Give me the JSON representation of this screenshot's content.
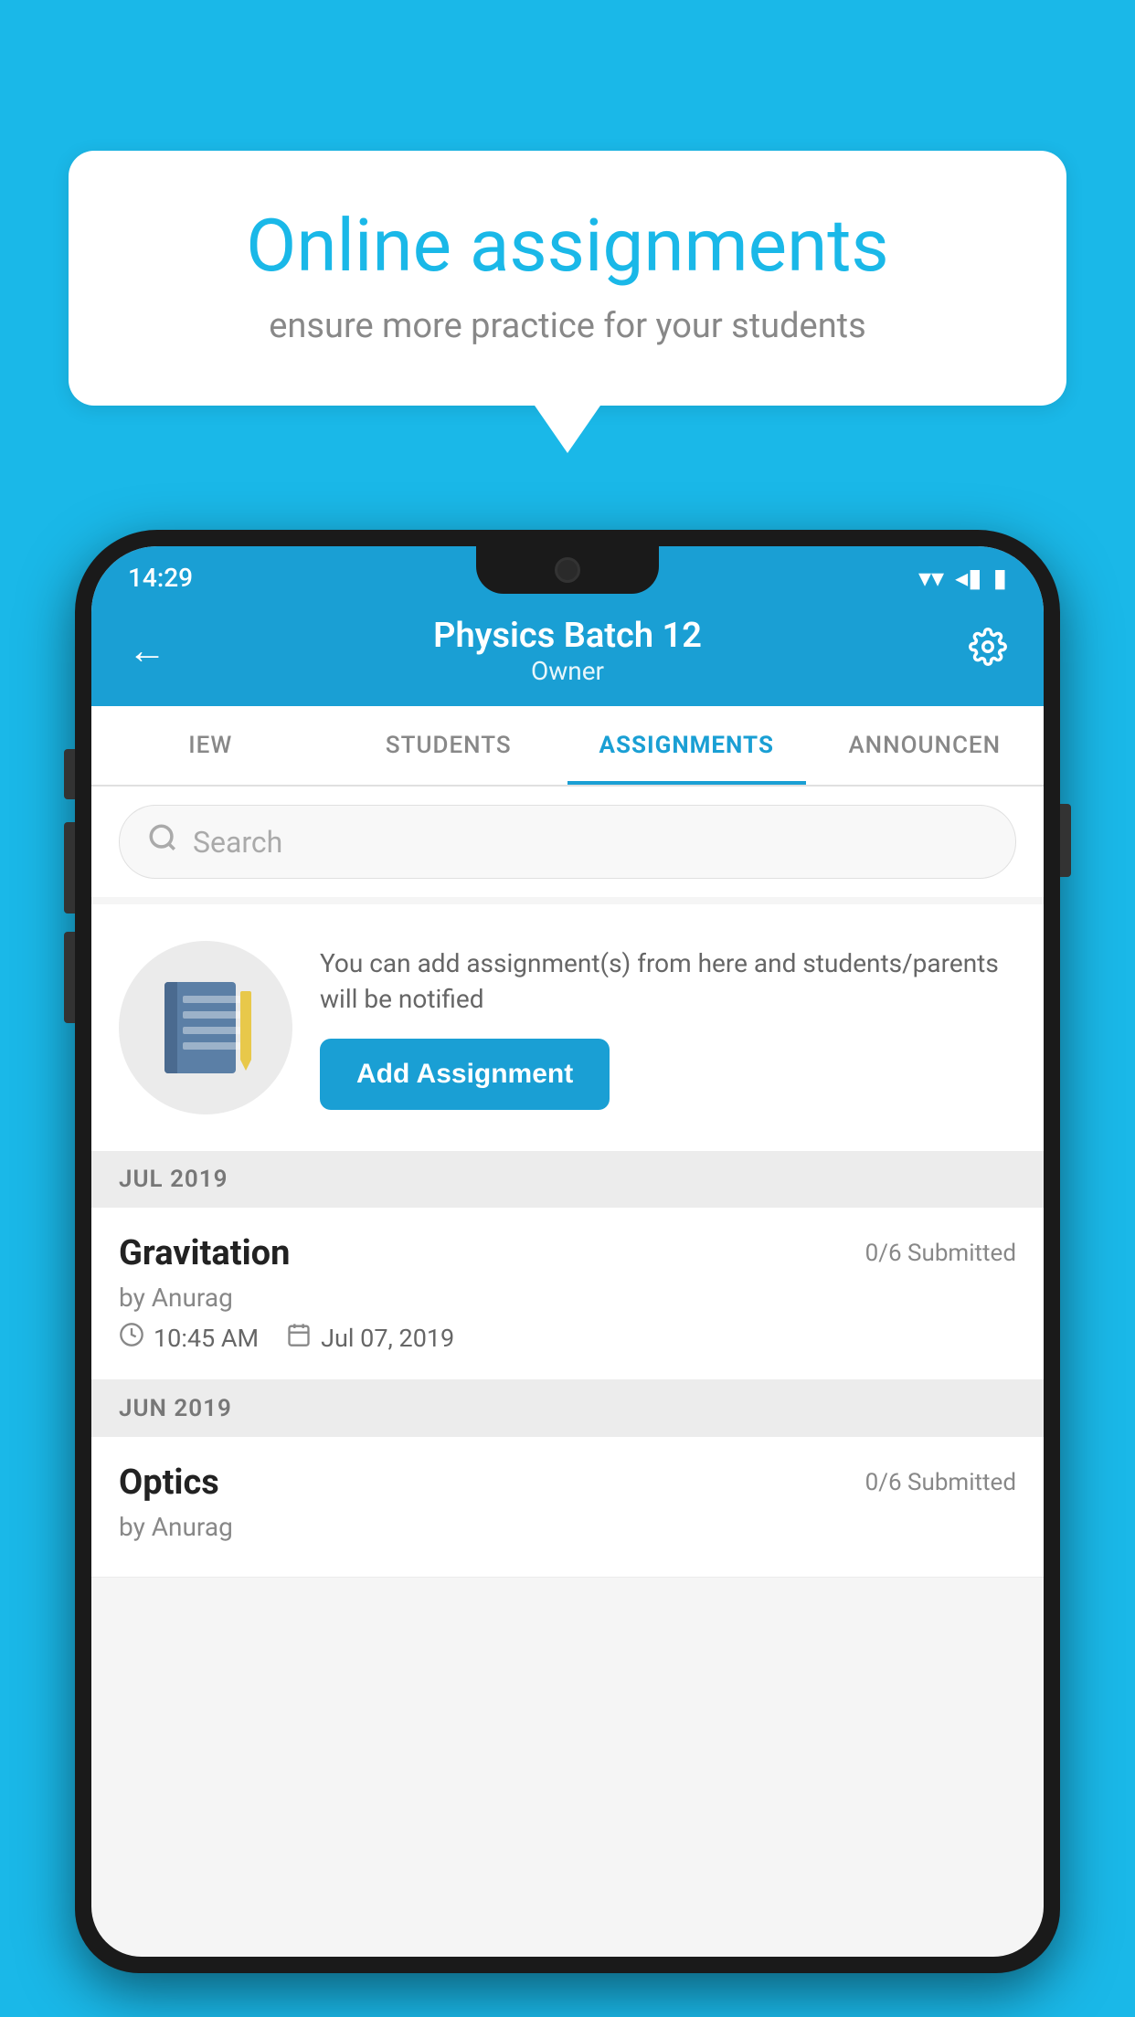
{
  "background_color": "#1ab8e8",
  "speech_bubble": {
    "title": "Online assignments",
    "subtitle": "ensure more practice for your students"
  },
  "status_bar": {
    "time": "14:29",
    "wifi": "▼",
    "signal": "◀",
    "battery": "▮"
  },
  "header": {
    "title": "Physics Batch 12",
    "subtitle": "Owner",
    "back_label": "←",
    "settings_label": "⚙"
  },
  "tabs": [
    {
      "id": "iew",
      "label": "IEW",
      "active": false
    },
    {
      "id": "students",
      "label": "STUDENTS",
      "active": false
    },
    {
      "id": "assignments",
      "label": "ASSIGNMENTS",
      "active": true
    },
    {
      "id": "announcements",
      "label": "ANNOUNCEN",
      "active": false
    }
  ],
  "search": {
    "placeholder": "Search"
  },
  "empty_state": {
    "description": "You can add assignment(s) from here and students/parents will be notified",
    "add_button_label": "Add Assignment"
  },
  "sections": [
    {
      "month_label": "JUL 2019",
      "assignments": [
        {
          "name": "Gravitation",
          "submitted": "0/6 Submitted",
          "by": "by Anurag",
          "time": "10:45 AM",
          "date": "Jul 07, 2019"
        }
      ]
    },
    {
      "month_label": "JUN 2019",
      "assignments": [
        {
          "name": "Optics",
          "submitted": "0/6 Submitted",
          "by": "by Anurag",
          "time": "",
          "date": ""
        }
      ]
    }
  ]
}
